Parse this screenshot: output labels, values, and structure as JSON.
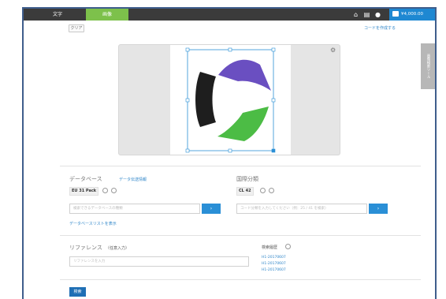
{
  "topbar": {
    "tab_text": "文字",
    "tab_active": "画像",
    "account_amount": "¥4,000.00"
  },
  "toolbar": {
    "clear_label": "クリア",
    "code_link": "コードを作成する"
  },
  "side_tab": {
    "label": "画像検索ツール"
  },
  "database": {
    "title": "データベース",
    "selection_link": "データ伝送情報",
    "tag": "EU 31 Pack",
    "input_placeholder": "検索できるデータベースの種類",
    "list_link": "データベースリストを表示"
  },
  "classification": {
    "title": "国際分類",
    "tag": "CL 42",
    "input_placeholder": "コード分類を入力してください（例：25 / 41 を検索）"
  },
  "reference": {
    "title": "リファレンス",
    "subtitle": "（任意入力）",
    "input_placeholder": "リファレンスを入力"
  },
  "history": {
    "title": "検索履歴",
    "items": [
      "H1-20170607",
      "H1-20170607",
      "H1-20170607"
    ]
  },
  "search_button": "検索",
  "colors": {
    "topbar": "#3b3b3b",
    "accent_green": "#7dc14b",
    "accent_blue": "#2a8fd6",
    "logo_purple": "#6a4fc1",
    "logo_green": "#4cbc45",
    "logo_black": "#1e1e1e"
  }
}
